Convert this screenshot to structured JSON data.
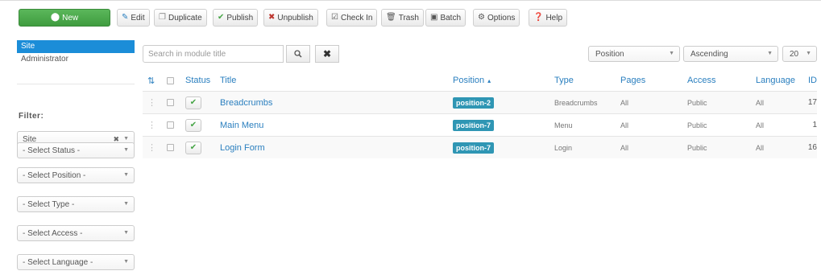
{
  "toolbar": {
    "new": "New",
    "edit": "Edit",
    "duplicate": "Duplicate",
    "publish": "Publish",
    "unpublish": "Unpublish",
    "checkin": "Check In",
    "trash": "Trash",
    "batch": "Batch",
    "options": "Options",
    "help": "Help"
  },
  "sidebar": {
    "items": [
      {
        "label": "Site",
        "active": true
      },
      {
        "label": "Administrator",
        "active": false
      }
    ],
    "filter_title": "Filter:",
    "filters": [
      {
        "value": "Site"
      },
      {
        "value": "- Select Status -"
      },
      {
        "value": "- Select Position -"
      },
      {
        "value": "- Select Type -"
      },
      {
        "value": "- Select Access -"
      },
      {
        "value": "- Select Language -"
      }
    ]
  },
  "search": {
    "placeholder": "Search in module title",
    "value": ""
  },
  "list_controls": {
    "ordering": "Position",
    "direction": "Ascending",
    "limit": "20"
  },
  "table": {
    "headers": {
      "status": "Status",
      "title": "Title",
      "position": "Position",
      "type": "Type",
      "pages": "Pages",
      "access": "Access",
      "language": "Language",
      "id": "ID"
    },
    "rows": [
      {
        "title": "Breadcrumbs",
        "position": "position-2",
        "type": "Breadcrumbs",
        "pages": "All",
        "access": "Public",
        "language": "All",
        "id": "17"
      },
      {
        "title": "Main Menu",
        "position": "position-7",
        "type": "Menu",
        "pages": "All",
        "access": "Public",
        "language": "All",
        "id": "1"
      },
      {
        "title": "Login Form",
        "position": "position-7",
        "type": "Login",
        "pages": "All",
        "access": "Public",
        "language": "All",
        "id": "16"
      }
    ]
  }
}
